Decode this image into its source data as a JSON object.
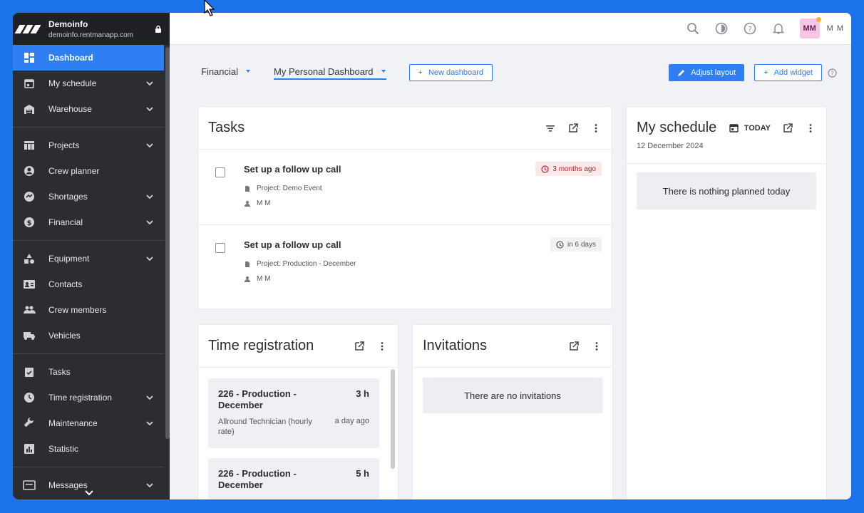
{
  "org": {
    "name": "Demoinfo",
    "url": "demoinfo.rentmanapp.com"
  },
  "sidebar": {
    "items": [
      {
        "label": "Dashboard",
        "icon": "dashboard-icon"
      },
      {
        "label": "My schedule",
        "icon": "calendar-icon"
      },
      {
        "label": "Warehouse",
        "icon": "warehouse-icon"
      },
      {
        "label": "Projects",
        "icon": "projects-icon"
      },
      {
        "label": "Crew planner",
        "icon": "person-icon"
      },
      {
        "label": "Shortages",
        "icon": "shortages-icon"
      },
      {
        "label": "Financial",
        "icon": "dollar-icon"
      },
      {
        "label": "Equipment",
        "icon": "equipment-icon"
      },
      {
        "label": "Contacts",
        "icon": "contacts-icon"
      },
      {
        "label": "Crew members",
        "icon": "group-icon"
      },
      {
        "label": "Vehicles",
        "icon": "truck-icon"
      },
      {
        "label": "Tasks",
        "icon": "tasks-icon"
      },
      {
        "label": "Time registration",
        "icon": "clock-icon"
      },
      {
        "label": "Maintenance",
        "icon": "wrench-icon"
      },
      {
        "label": "Statistic",
        "icon": "chart-icon"
      },
      {
        "label": "Messages",
        "icon": "message-icon"
      }
    ]
  },
  "topbar": {
    "avatar_initials": "MM",
    "user_initials": "M M"
  },
  "dashboard": {
    "financial_label": "Financial",
    "personal_label": "My Personal Dashboard",
    "new_dashboard": "New dashboard",
    "adjust_layout": "Adjust layout",
    "add_widget": "Add widget"
  },
  "tasks": {
    "title": "Tasks",
    "items": [
      {
        "title": "Set up a follow up call",
        "project": "Project: Demo Event",
        "user": "M M",
        "due": "3 months ago"
      },
      {
        "title": "Set up a follow up call",
        "project": "Project: Production - December",
        "user": "M M",
        "due": "in 6 days"
      }
    ]
  },
  "schedule": {
    "title": "My schedule",
    "today": "TODAY",
    "date": "12 December 2024",
    "empty": "There is nothing planned today"
  },
  "time_registration": {
    "title": "Time registration",
    "entries": [
      {
        "title": "226 - Production - December",
        "hours": "3 h",
        "desc": "Allround Technician (hourly rate)",
        "when": "a day ago"
      },
      {
        "title": "226 - Production - December",
        "hours": "5 h"
      }
    ]
  },
  "invitations": {
    "title": "Invitations",
    "empty": "There are no invitations"
  },
  "colors": {
    "accent": "#2f7ef2",
    "sidebar_bg": "#2b2d31",
    "overdue": "#b3263a",
    "avatar_bg": "#f6c6e4"
  }
}
